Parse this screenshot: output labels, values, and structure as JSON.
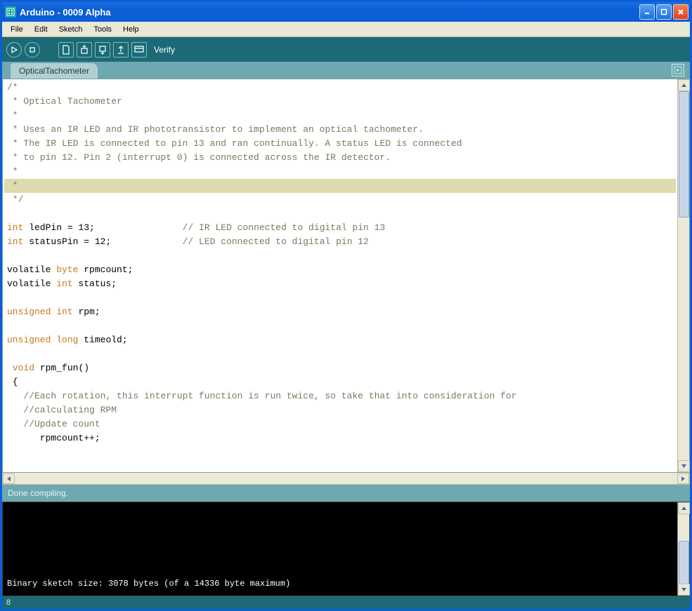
{
  "window": {
    "title": "Arduino - 0009 Alpha"
  },
  "menubar": [
    "File",
    "Edit",
    "Sketch",
    "Tools",
    "Help"
  ],
  "toolbar": {
    "label": "Verify"
  },
  "tabs": [
    "OpticalTachometer"
  ],
  "code": {
    "lines": [
      {
        "text": "/*",
        "cls": "cmt"
      },
      {
        "text": " * Optical Tachometer",
        "cls": "cmt"
      },
      {
        "text": " *",
        "cls": "cmt"
      },
      {
        "text": " * Uses an IR LED and IR phototransistor to implement an optical tachometer.",
        "cls": "cmt"
      },
      {
        "text": " * The IR LED is connected to pin 13 and ran continually. A status LED is connected",
        "cls": "cmt"
      },
      {
        "text": " * to pin 12. Pin 2 (interrupt 0) is connected across the IR detector.",
        "cls": "cmt"
      },
      {
        "text": " *",
        "cls": "cmt"
      },
      {
        "text": " *",
        "cls": "cmt hl"
      },
      {
        "text": " */",
        "cls": "cmt"
      },
      {
        "text": "",
        "cls": ""
      },
      {
        "html": "<span class='kw'>int</span> ledPin = 13;                <span class='cmt'>// IR LED connected to digital pin 13</span>"
      },
      {
        "html": "<span class='kw'>int</span> statusPin = 12;             <span class='cmt'>// LED connected to digital pin 12</span>"
      },
      {
        "text": "",
        "cls": ""
      },
      {
        "html": "volatile <span class='kw'>byte</span> rpmcount;"
      },
      {
        "html": "volatile <span class='kw'>int</span> status;"
      },
      {
        "text": "",
        "cls": ""
      },
      {
        "html": "<span class='kw'>unsigned</span> <span class='kw'>int</span> rpm;"
      },
      {
        "text": "",
        "cls": ""
      },
      {
        "html": "<span class='kw'>unsigned</span> <span class='kw'>long</span> timeold;"
      },
      {
        "text": "",
        "cls": ""
      },
      {
        "html": " <span class='kw'>void</span> rpm_fun()"
      },
      {
        "text": " {",
        "cls": ""
      },
      {
        "html": "   <span class='cmt'>//Each rotation, this interrupt function is run twice, so take that into consideration for</span>"
      },
      {
        "html": "   <span class='cmt'>//calculating RPM</span>"
      },
      {
        "html": "   <span class='cmt'>//Update count</span>"
      },
      {
        "text": "      rpmcount++;",
        "cls": ""
      }
    ]
  },
  "status": {
    "message": "Done compiling."
  },
  "console": {
    "output": "Binary sketch size: 3078 bytes (of a 14336 byte maximum)"
  },
  "footer": {
    "line": "8"
  }
}
